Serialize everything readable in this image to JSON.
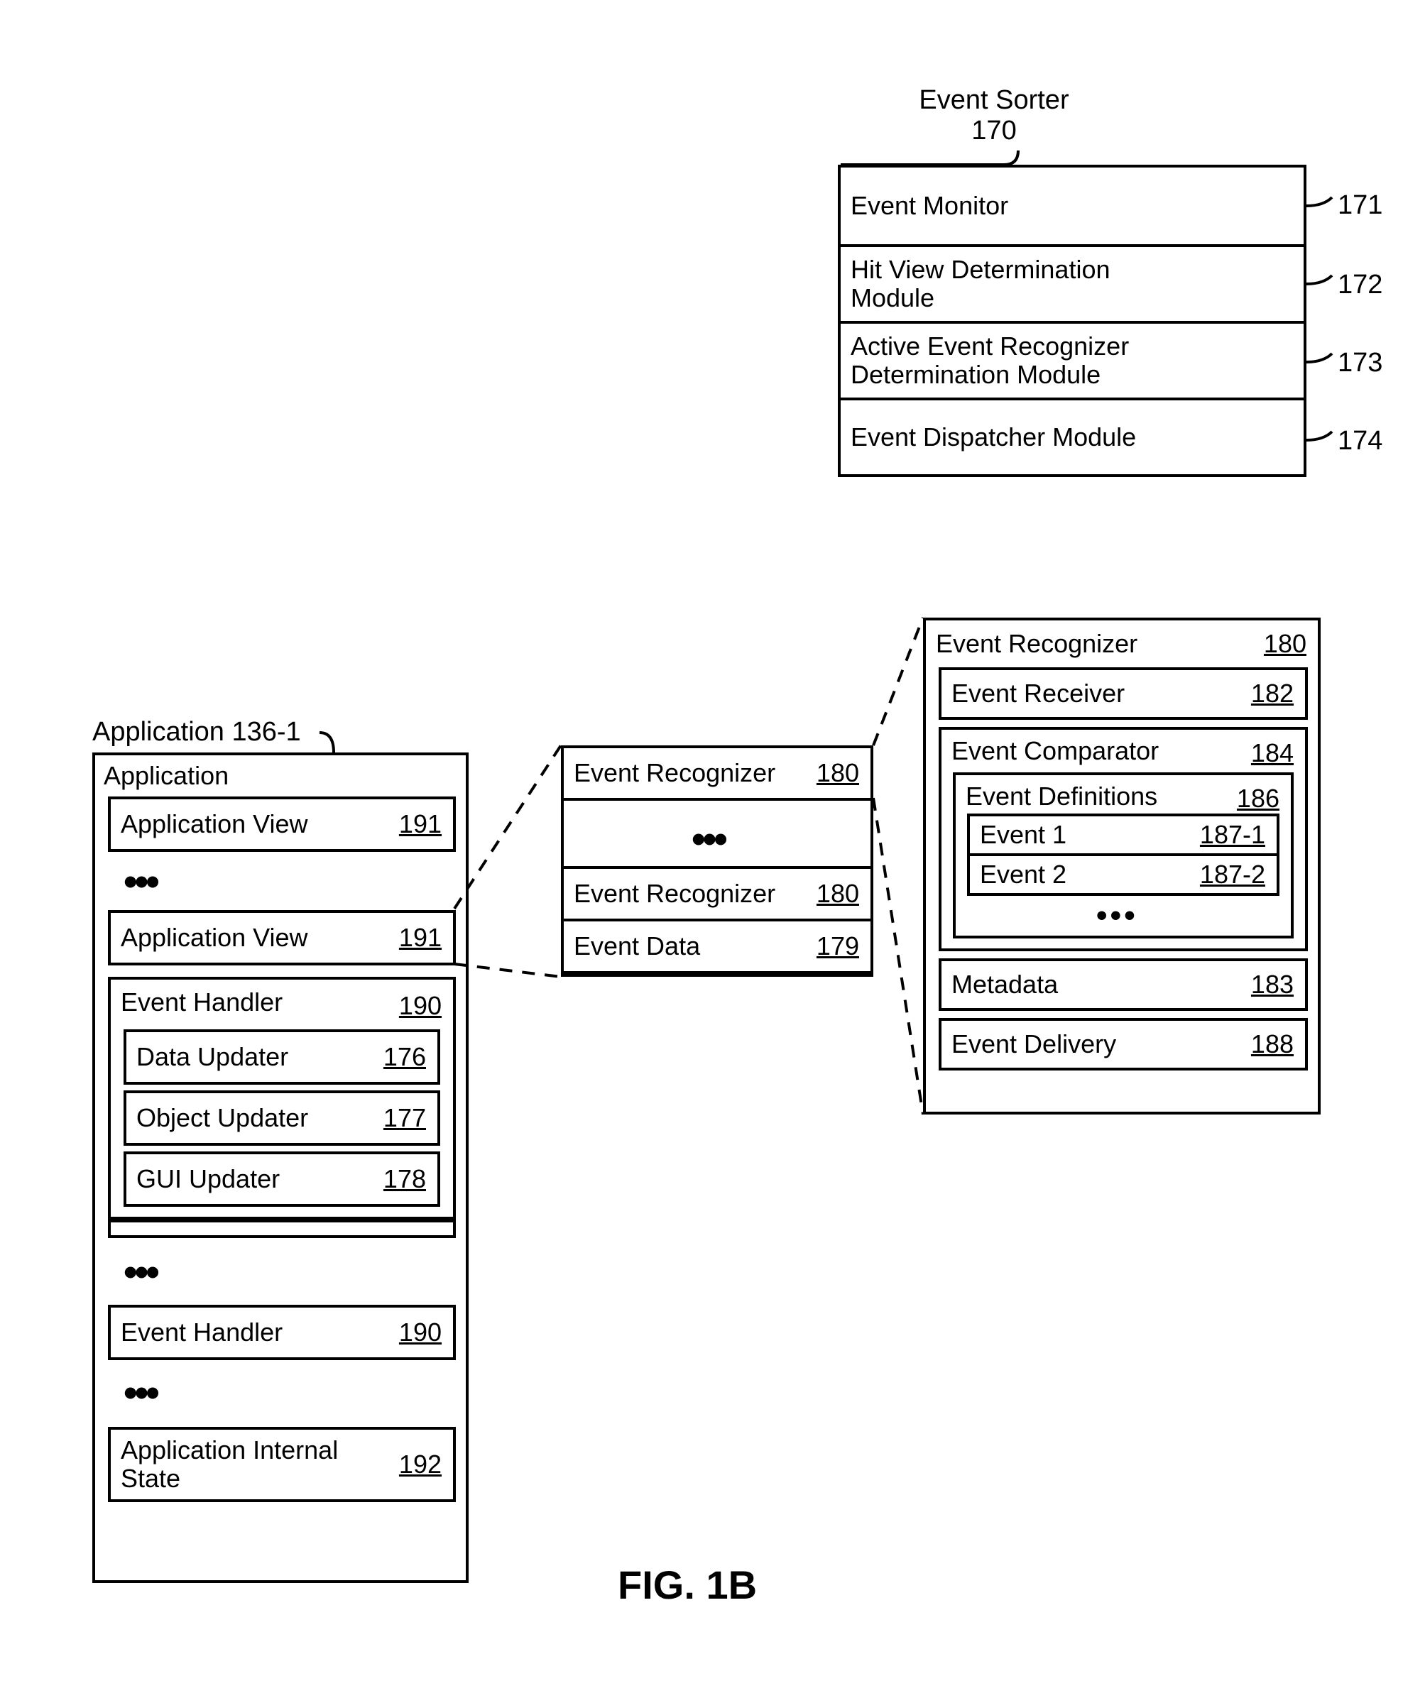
{
  "eventSorter": {
    "title": "Event Sorter",
    "ref": "170",
    "rows": [
      {
        "label": "Event Monitor",
        "ref": "171"
      },
      {
        "label": "Hit View Determination\nModule",
        "ref": "172"
      },
      {
        "label": "Active Event Recognizer\nDetermination Module",
        "ref": "173"
      },
      {
        "label": "Event Dispatcher Module",
        "ref": "174"
      }
    ]
  },
  "application": {
    "title": "Application 136-1",
    "containerLabel": "Application",
    "rows": {
      "appView1": {
        "label": "Application View",
        "ref": "191"
      },
      "appView2": {
        "label": "Application View",
        "ref": "191"
      },
      "eventHandler1": {
        "label": "Event Handler",
        "ref": "190"
      },
      "dataUpdater": {
        "label": "Data Updater",
        "ref": "176"
      },
      "objectUpdater": {
        "label": "Object Updater",
        "ref": "177"
      },
      "guiUpdater": {
        "label": "GUI Updater",
        "ref": "178"
      },
      "eventHandler2": {
        "label": "Event Handler",
        "ref": "190"
      },
      "appInternalState": {
        "label": "Application Internal\nState",
        "ref": "192"
      }
    }
  },
  "appViewDetail": {
    "rows": {
      "rec1": {
        "label": "Event Recognizer",
        "ref": "180"
      },
      "rec2": {
        "label": "Event Recognizer",
        "ref": "180"
      },
      "eventData": {
        "label": "Event Data",
        "ref": "179"
      }
    }
  },
  "recognizerDetail": {
    "header": {
      "label": "Event Recognizer",
      "ref": "180"
    },
    "rows": {
      "receiver": {
        "label": "Event Receiver",
        "ref": "182"
      },
      "comparator": {
        "label": "Event Comparator",
        "ref": "184"
      },
      "definitions": {
        "label": "Event Definitions",
        "ref": "186"
      },
      "event1": {
        "label": "Event 1",
        "ref": "187-1"
      },
      "event2": {
        "label": "Event 2",
        "ref": "187-2"
      },
      "metadata": {
        "label": "Metadata",
        "ref": "183"
      },
      "eventDelivery": {
        "label": "Event Delivery",
        "ref": "188"
      }
    }
  },
  "figureLabel": "FIG. 1B",
  "ellipsis": "•••"
}
